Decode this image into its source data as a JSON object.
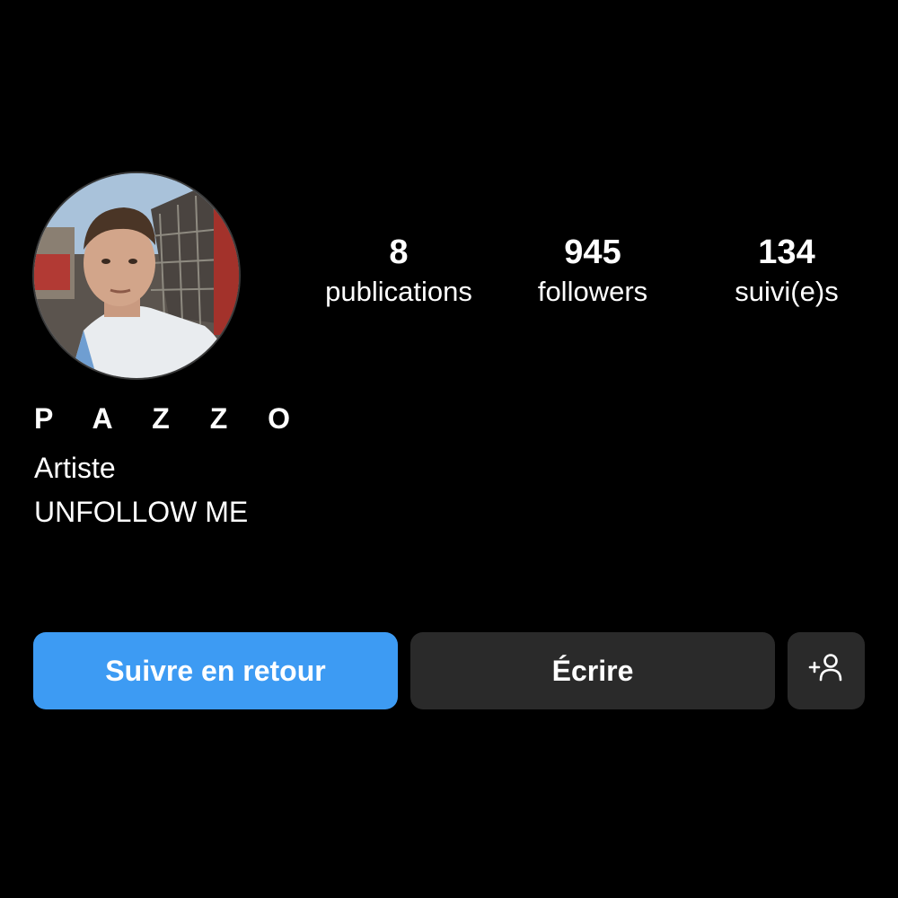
{
  "profile": {
    "display_name": "P A Z Z O",
    "category": "Artiste",
    "bio": "UNFOLLOW ME"
  },
  "stats": {
    "posts": {
      "value": "8",
      "label": "publications"
    },
    "followers": {
      "value": "945",
      "label": "followers"
    },
    "following": {
      "value": "134",
      "label": "suivi(e)s"
    }
  },
  "actions": {
    "follow_back_label": "Suivre en retour",
    "message_label": "Écrire",
    "add_user_icon": "person-add-icon"
  },
  "colors": {
    "background": "#000000",
    "primary_button": "#3d9bf3",
    "secondary_button": "#2a2a2a",
    "text": "#ffffff"
  }
}
